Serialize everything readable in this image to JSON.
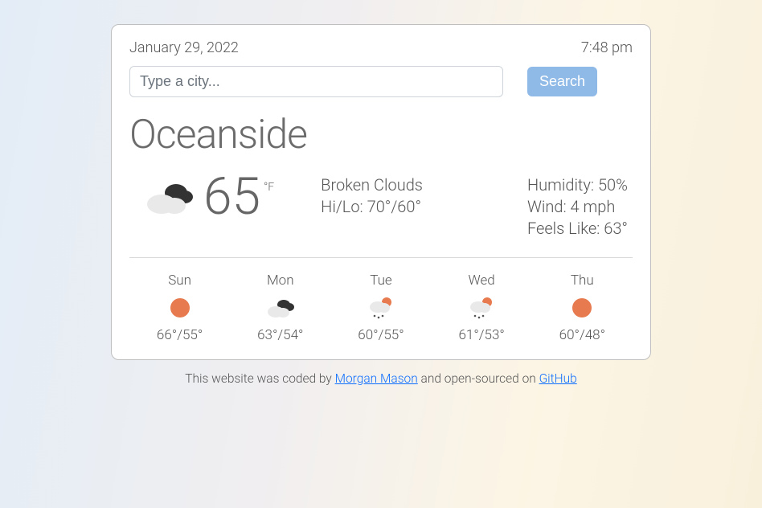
{
  "header": {
    "date": "January 29, 2022",
    "time": "7:48 pm"
  },
  "search": {
    "placeholder": "Type a city...",
    "value": "",
    "button_label": "Search"
  },
  "city": "Oceanside",
  "current": {
    "icon": "broken-clouds",
    "temp": "65",
    "unit": "°F",
    "condition": "Broken Clouds",
    "hilo_label": "Hi/Lo: 70°/60°",
    "humidity_label": "Humidity: 50%",
    "wind_label": "Wind: 4 mph",
    "feels_label": "Feels Like: 63°"
  },
  "forecast": [
    {
      "day": "Sun",
      "icon": "sun",
      "hilo": "66°/55°"
    },
    {
      "day": "Mon",
      "icon": "broken-clouds",
      "hilo": "63°/54°"
    },
    {
      "day": "Tue",
      "icon": "sun-rain",
      "hilo": "60°/55°"
    },
    {
      "day": "Wed",
      "icon": "sun-rain",
      "hilo": "61°/53°"
    },
    {
      "day": "Thu",
      "icon": "sun",
      "hilo": "60°/48°"
    }
  ],
  "footer": {
    "prefix": "This website was coded by ",
    "author": "Morgan Mason",
    "mid": " and open-sourced on ",
    "repo": "GitHub"
  }
}
